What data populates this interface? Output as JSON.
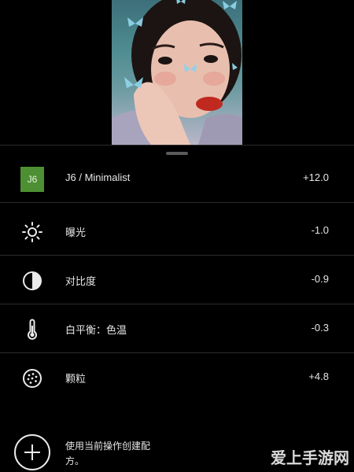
{
  "adjustments": [
    {
      "icon": "preset-badge",
      "badge_text": "J6",
      "label": "J6 / Minimalist",
      "value": "+12.0"
    },
    {
      "icon": "exposure-icon",
      "label": "曝光",
      "value": "-1.0"
    },
    {
      "icon": "contrast-icon",
      "label": "对比度",
      "value": "-0.9"
    },
    {
      "icon": "thermometer-icon",
      "label": "白平衡：色温",
      "value": "-0.3"
    },
    {
      "icon": "grain-icon",
      "label": "颗粒",
      "value": "+4.8"
    }
  ],
  "create_preset": {
    "label": "使用当前操作创建配方。"
  },
  "watermark": "爱上手游网",
  "colors": {
    "preset_badge": "#4d8f33",
    "background": "#000000"
  }
}
